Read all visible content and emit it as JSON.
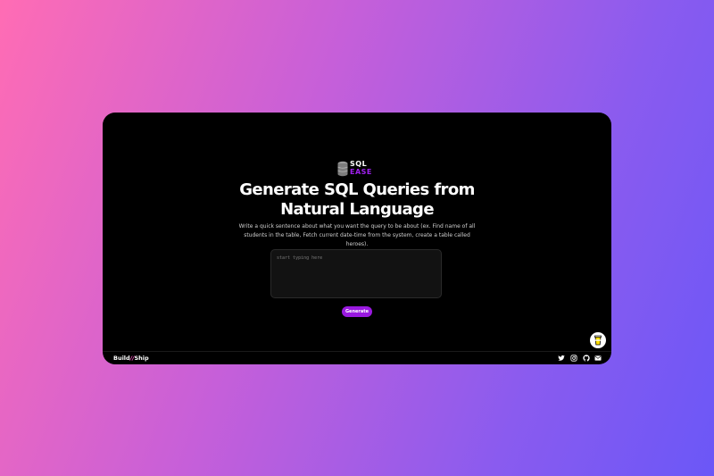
{
  "logo": {
    "line1": "SQL",
    "line2": "EASE",
    "icon": "database-icon",
    "colors": {
      "primary": "#ffffff",
      "accent": "#a020f0",
      "icon": "#8a8a8a"
    }
  },
  "hero": {
    "title_line1": "Generate SQL Queries from",
    "title_line2": "Natural Language",
    "description": "Write a quick sentence about what you want the query to be about (ex. Find name of all students in the table, Fetch current date-time from the system, create a table called heroes)."
  },
  "query_input": {
    "placeholder": "start typing here",
    "value": ""
  },
  "generate_button": {
    "label": "Generate",
    "color": "#9a19e0"
  },
  "floating": {
    "icon": "coffee-cup-icon"
  },
  "footer": {
    "brand_part1": "Build",
    "brand_symbol": "//",
    "brand_part2": "Ship",
    "social_icons": [
      "twitter-icon",
      "instagram-icon",
      "github-icon",
      "email-icon"
    ]
  },
  "background": {
    "gradient_start": "#ff6cb4",
    "gradient_end": "#6b57f7"
  }
}
